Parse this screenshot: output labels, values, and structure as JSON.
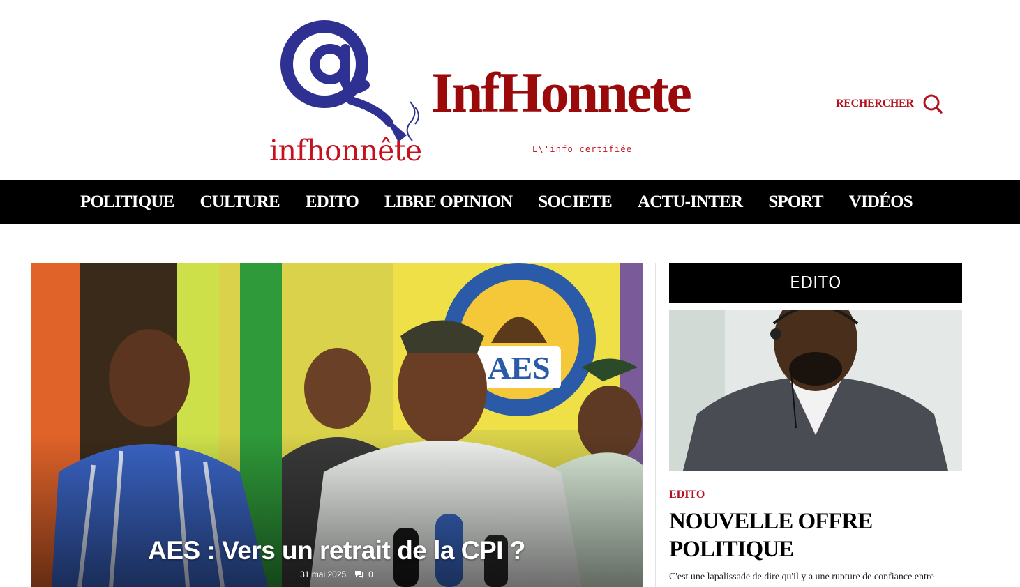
{
  "site": {
    "logo_text": "infhonnête",
    "brand_title": "InfHonnete",
    "tagline": "L\\'info certifiée"
  },
  "search": {
    "label": "RECHERCHER",
    "icon": "search-icon"
  },
  "nav": {
    "items": [
      {
        "label": "POLITIQUE"
      },
      {
        "label": "CULTURE"
      },
      {
        "label": "EDITO"
      },
      {
        "label": "LIBRE OPINION"
      },
      {
        "label": "SOCIETE"
      },
      {
        "label": "ACTU-INTER"
      },
      {
        "label": "SPORT"
      },
      {
        "label": "VIDÉOS"
      }
    ]
  },
  "hero": {
    "title": "AES : Vers un retrait de la CPI ?",
    "date": "31 mai 2025",
    "comments": "0",
    "comment_icon": "comment-icon",
    "banner_text": "AES"
  },
  "sidebar": {
    "heading": "EDITO",
    "category": "EDITO",
    "title": "NOUVELLE OFFRE POLITIQUE",
    "excerpt": "C'est une lapalissade de dire qu'il y a une rupture de confiance entre"
  },
  "colors": {
    "brand_red": "#9a0a0a",
    "accent_red": "#c4121f",
    "logo_blue": "#2e3192",
    "nav_bg": "#000000",
    "nav_text": "#ffffff"
  }
}
